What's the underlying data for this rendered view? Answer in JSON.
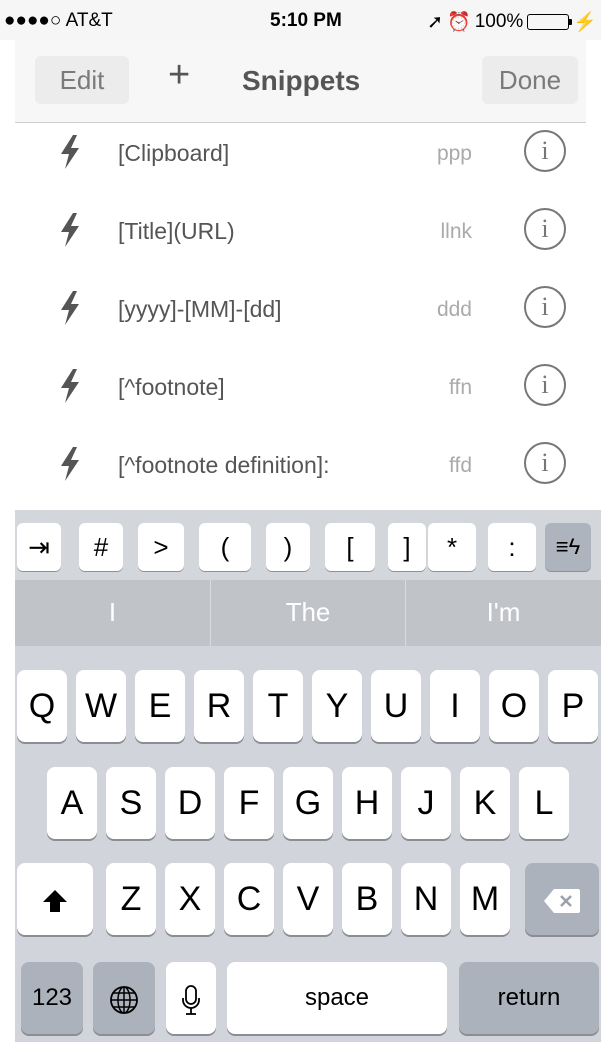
{
  "status": {
    "carrier": "●●●●○ AT&T",
    "time": "5:10 PM",
    "battery": "100%",
    "battery_level": 1.0
  },
  "nav": {
    "edit_label": "Edit",
    "plus_label": "+",
    "title": "Snippets",
    "done_label": "Done"
  },
  "snippets": [
    {
      "text": "[Clipboard]",
      "abbr": "ppp"
    },
    {
      "text": "[Title](URL)",
      "abbr": "llnk"
    },
    {
      "text": "[yyyy]-[MM]-[dd]",
      "abbr": "ddd"
    },
    {
      "text": "[^footnote]",
      "abbr": "ffn"
    },
    {
      "text": "[^footnote definition]:",
      "abbr": "ffd"
    }
  ],
  "accessory_keys": [
    "⇥",
    "#",
    ">",
    "(",
    ")",
    "[",
    "]",
    "*",
    ":",
    "≡ϟ"
  ],
  "predictions": [
    "I",
    "The",
    "I'm"
  ],
  "keyboard": {
    "row1": [
      "Q",
      "W",
      "E",
      "R",
      "T",
      "Y",
      "U",
      "I",
      "O",
      "P"
    ],
    "row2": [
      "A",
      "S",
      "D",
      "F",
      "G",
      "H",
      "J",
      "K",
      "L"
    ],
    "row3": [
      "Z",
      "X",
      "C",
      "V",
      "B",
      "N",
      "M"
    ],
    "numbers_label": "123",
    "space_label": "space",
    "return_label": "return"
  },
  "colors": {
    "accent_gray": "#555555",
    "battery_green": "#4cd964"
  }
}
